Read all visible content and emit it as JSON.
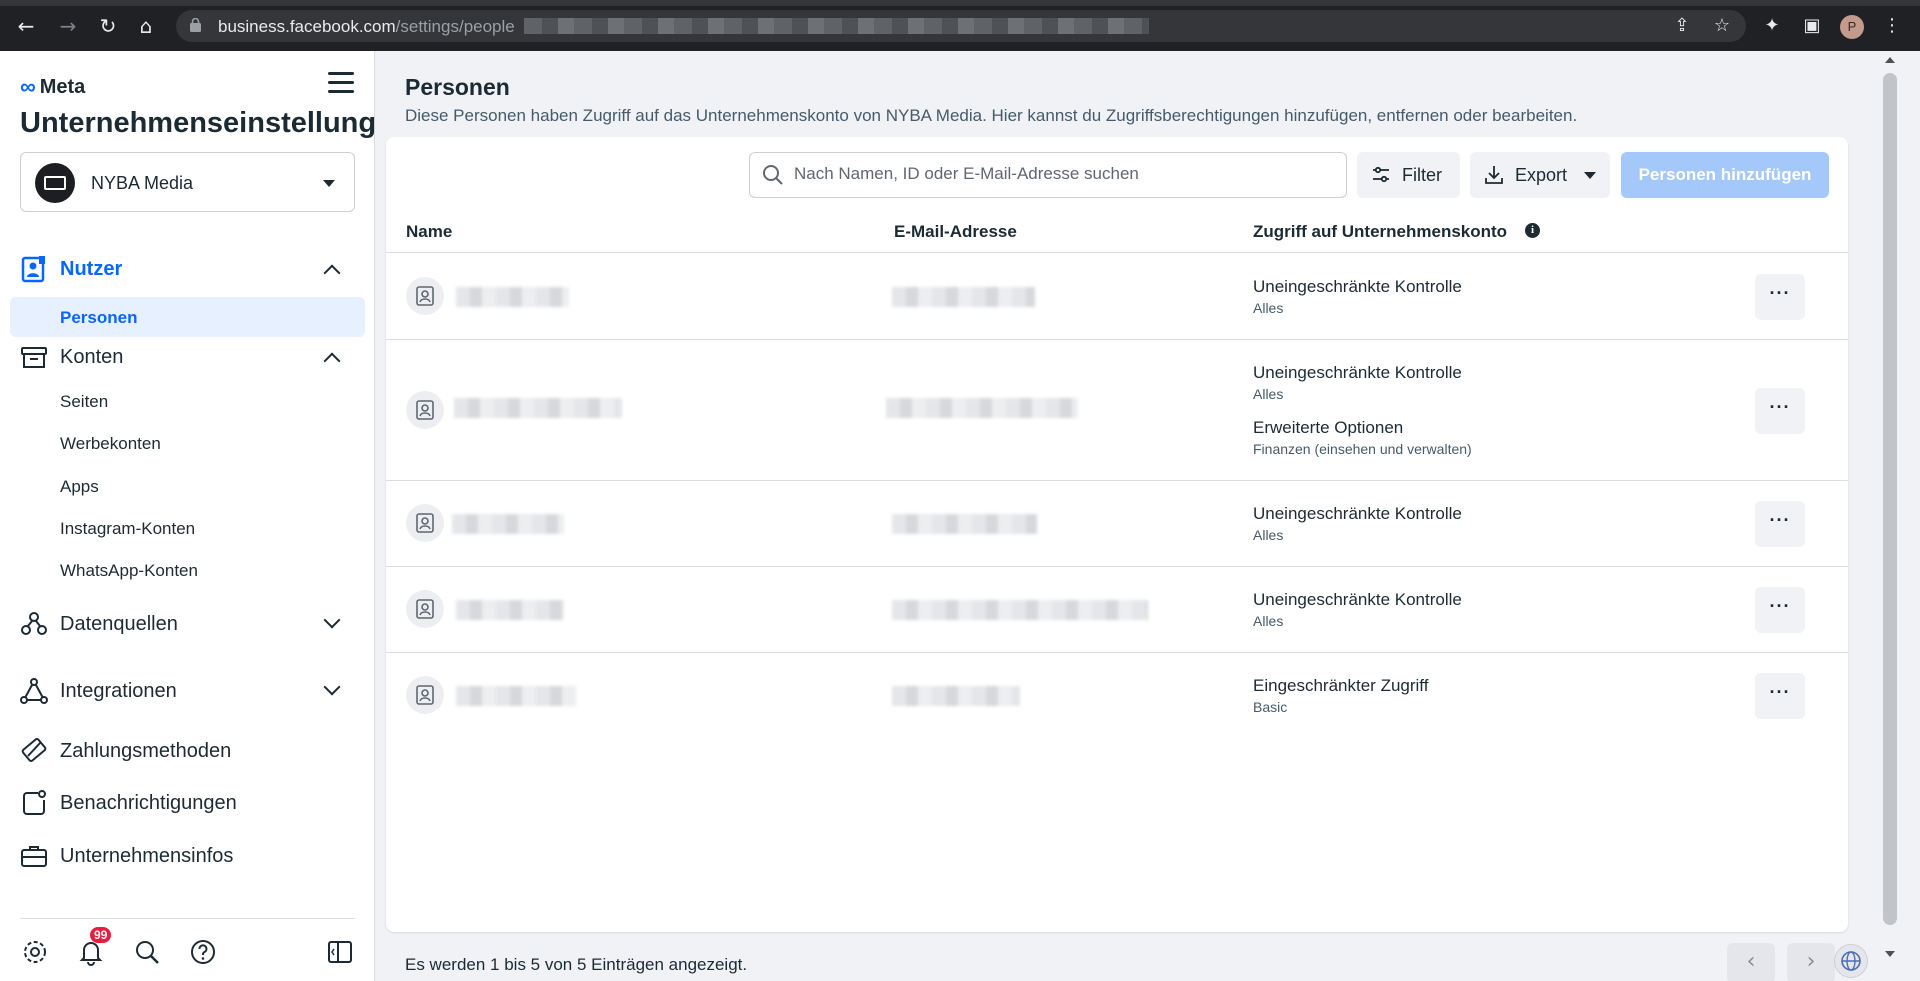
{
  "browser": {
    "url_host": "business.facebook.com",
    "url_path": "/settings/people",
    "profile_initial": "P"
  },
  "sidebar": {
    "brand": "Meta",
    "title": "Unternehmenseinstellungen",
    "business_name": "NYBA Media",
    "sections": {
      "nutzer": "Nutzer",
      "personen": "Personen",
      "konten": "Konten",
      "seiten": "Seiten",
      "werbekonten": "Werbekonten",
      "apps": "Apps",
      "instagram": "Instagram-Konten",
      "whatsapp": "WhatsApp-Konten",
      "datenquellen": "Datenquellen",
      "integrationen": "Integrationen",
      "zahlungsmethoden": "Zahlungsmethoden",
      "benachrichtigungen": "Benachrichtigungen",
      "unternehmensinfos": "Unternehmensinfos"
    },
    "notification_count": "99"
  },
  "main": {
    "title": "Personen",
    "description": "Diese Personen haben Zugriff auf das Unternehmenskonto von NYBA Media. Hier kannst du Zugriffsberechtigungen hinzufügen, entfernen oder bearbeiten.",
    "search_placeholder": "Nach Namen, ID oder E-Mail-Adresse suchen",
    "filter_label": "Filter",
    "export_label": "Export",
    "add_label": "Personen hinzufügen",
    "columns": {
      "name": "Name",
      "email": "E-Mail-Adresse",
      "access": "Zugriff auf Unternehmenskonto"
    },
    "rows": [
      {
        "access": [
          {
            "title": "Uneingeschränkte Kontrolle",
            "sub": "Alles"
          }
        ]
      },
      {
        "access": [
          {
            "title": "Uneingeschränkte Kontrolle",
            "sub": "Alles"
          },
          {
            "title": "Erweiterte Optionen",
            "sub": "Finanzen (einsehen und verwalten)"
          }
        ]
      },
      {
        "access": [
          {
            "title": "Uneingeschränkte Kontrolle",
            "sub": "Alles"
          }
        ]
      },
      {
        "access": [
          {
            "title": "Uneingeschränkte Kontrolle",
            "sub": "Alles"
          }
        ]
      },
      {
        "access": [
          {
            "title": "Eingeschränkter Zugriff",
            "sub": "Basic"
          }
        ]
      }
    ],
    "more_label": "···",
    "footer": "Es werden 1 bis 5 von 5 Einträgen angezeigt."
  },
  "colors": {
    "accent": "#0866ff",
    "add_button_disabled": "#a5c8fb",
    "selected_bg": "#e7f0ff"
  }
}
